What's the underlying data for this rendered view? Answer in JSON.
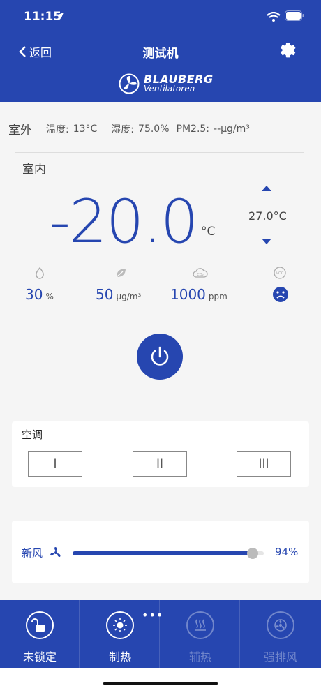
{
  "status_bar": {
    "time": "11:15"
  },
  "nav": {
    "back_label": "返回",
    "title": "测试机"
  },
  "logo": {
    "name": "BLAUBERG",
    "sub": "Ventilatoren"
  },
  "outdoor": {
    "label": "室外",
    "temp_label": "温度:",
    "temp_value": "13°C",
    "humidity_label": "湿度:",
    "humidity_value": "75.0%",
    "pm_label": "PM2.5:",
    "pm_value": "--μg/m³"
  },
  "indoor": {
    "label": "室内",
    "temperature": "-20.0",
    "temp_unit": "°C",
    "setpoint": "27.0°C",
    "humidity": {
      "value": "30",
      "unit": "%"
    },
    "pm": {
      "value": "50",
      "unit": "μg/m³"
    },
    "co2": {
      "value": "1000",
      "unit": "ppm"
    },
    "voc_icon": "sad-face-icon"
  },
  "ac": {
    "title": "空调",
    "buttons": [
      "I",
      "II",
      "III"
    ]
  },
  "fresh_air": {
    "label": "新风",
    "percent_label": "94%",
    "level": 0.94
  },
  "tabs": [
    {
      "label": "未锁定",
      "icon": "unlock-icon",
      "enabled": true
    },
    {
      "label": "制热",
      "icon": "sun-icon",
      "enabled": true,
      "more": "•••"
    },
    {
      "label": "辅热",
      "icon": "heater-icon",
      "enabled": false
    },
    {
      "label": "强排风",
      "icon": "exhaust-fan-icon",
      "enabled": false
    }
  ],
  "colors": {
    "primary": "#2646b0",
    "background": "#f5f5f5"
  }
}
